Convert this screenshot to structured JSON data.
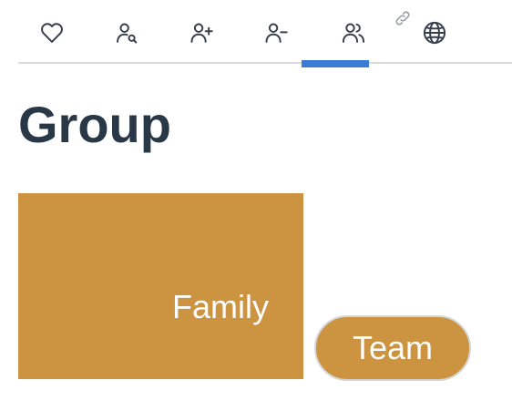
{
  "tabs": [
    {
      "icon": "heart-icon"
    },
    {
      "icon": "user-search-icon"
    },
    {
      "icon": "user-plus-icon"
    },
    {
      "icon": "user-minus-icon"
    },
    {
      "icon": "users-icon",
      "active": true
    },
    {
      "icon": "globe-icon"
    }
  ],
  "link_icon": "link-icon",
  "page": {
    "title": "Group"
  },
  "groups": {
    "family_label": "Family",
    "team_label": "Team"
  },
  "colors": {
    "accent": "#3a7bd5",
    "tile": "#cc9341",
    "title_text": "#293847",
    "icon": "#39404d"
  }
}
